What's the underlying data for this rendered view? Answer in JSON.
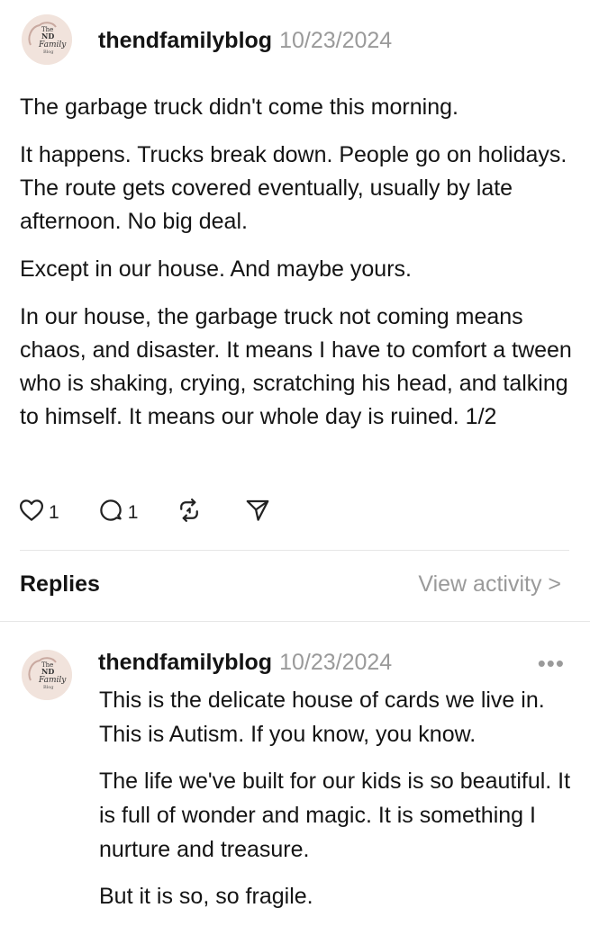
{
  "post": {
    "avatar_text": [
      "The",
      "ND",
      "Family",
      "Blog"
    ],
    "username": "thendfamilyblog",
    "date": "10/23/2024",
    "paragraphs": [
      "The garbage truck didn't come this morning.",
      "It happens. Trucks break down. People go on holidays. The route gets covered eventually, usually by late afternoon. No big deal.",
      "Except in our house. And maybe yours.",
      "In our house, the garbage truck not coming means chaos, and disaster. It means I have to comfort a tween who is shaking, crying, scratching his head, and talking to himself. It means our whole day is ruined. 1/2"
    ],
    "likes": "1",
    "comments": "1"
  },
  "replies_section": {
    "title": "Replies",
    "view_activity": "View activity >"
  },
  "reply": {
    "avatar_text": [
      "The",
      "ND",
      "Family",
      "Blog"
    ],
    "username": "thendfamilyblog",
    "date": "10/23/2024",
    "more": "•••",
    "paragraphs": [
      "This is the delicate house of cards we live in. This is Autism. If you know, you know.",
      "The life we've built for our kids is so beautiful. It is full of wonder and magic. It is something I nurture and treasure.",
      "But it is so, so fragile."
    ]
  },
  "colors": {
    "text": "#141414",
    "muted": "#9a9a9a",
    "avatar_bg": "#f1e3dc",
    "divider": "#e6e6e6"
  },
  "icons": [
    "heart-icon",
    "comment-icon",
    "repost-icon",
    "share-icon",
    "more-icon"
  ]
}
